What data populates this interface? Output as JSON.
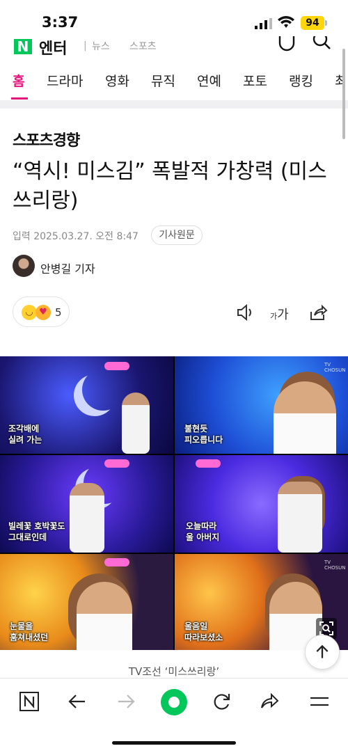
{
  "status": {
    "time": "3:37",
    "battery": "94"
  },
  "header": {
    "logo_letter": "N",
    "logo_text": "엔터",
    "sub1": "뉴스",
    "sub2": "스포츠"
  },
  "tabs": [
    "홈",
    "드라마",
    "영화",
    "뮤직",
    "연예",
    "포토",
    "랭킹",
    "최"
  ],
  "article": {
    "press": "스포츠경향",
    "headline": "“역시! 미스김” 폭발적 가창력 (미스쓰리랑)",
    "meta": "입력 2025.03.27. 오전 8:47",
    "original_button": "기사원문",
    "reporter": "안병길 기자",
    "reaction_count": "5",
    "font_tool_label": "가",
    "caption": "TV조선 ‘미스쓰리랑’"
  },
  "photo": {
    "subtitles": [
      "조각배에\n실려 가는",
      "불현듯\n피오릅니다",
      "빌레꽃 호박꽃도\n그대로인데",
      "오늘따라\n울 아버지",
      "눈물을\n훔쳐내셨던",
      "울음일\n따라보셨소"
    ],
    "broadcaster": "TV CHOSUN"
  },
  "colors": {
    "accent": "#e6157d",
    "brand": "#03c75a"
  },
  "icons": [
    "wifi-icon",
    "signal-icon",
    "search-icon",
    "speaker-icon",
    "share-icon",
    "scan-icon",
    "arrow-up-icon",
    "back-icon",
    "forward-icon",
    "refresh-icon",
    "menu-icon"
  ]
}
